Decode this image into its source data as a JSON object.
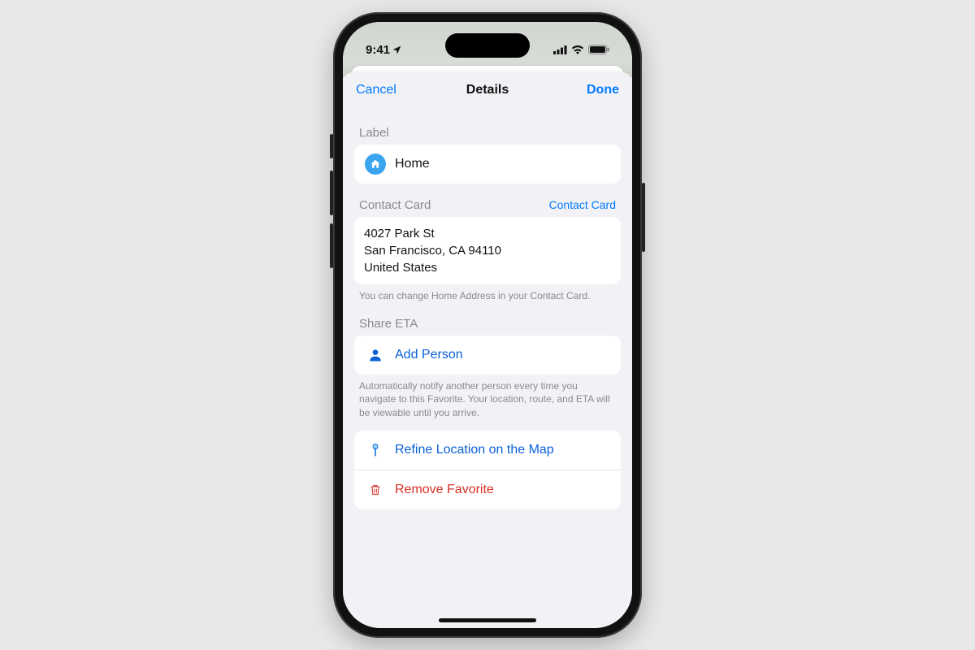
{
  "status": {
    "time": "9:41"
  },
  "nav": {
    "cancel": "Cancel",
    "title": "Details",
    "done": "Done"
  },
  "label": {
    "header": "Label",
    "value": "Home"
  },
  "contact": {
    "header": "Contact Card",
    "link": "Contact Card",
    "line1": "4027 Park St",
    "line2": "San Francisco, CA 94110",
    "line3": "United States",
    "footer": "You can change Home Address in your Contact Card."
  },
  "share": {
    "header": "Share ETA",
    "add": "Add Person",
    "footer": "Automatically notify another person every time you navigate to this Favorite. Your location, route, and ETA will be viewable until you arrive."
  },
  "actions": {
    "refine": "Refine Location on the Map",
    "remove": "Remove Favorite"
  }
}
